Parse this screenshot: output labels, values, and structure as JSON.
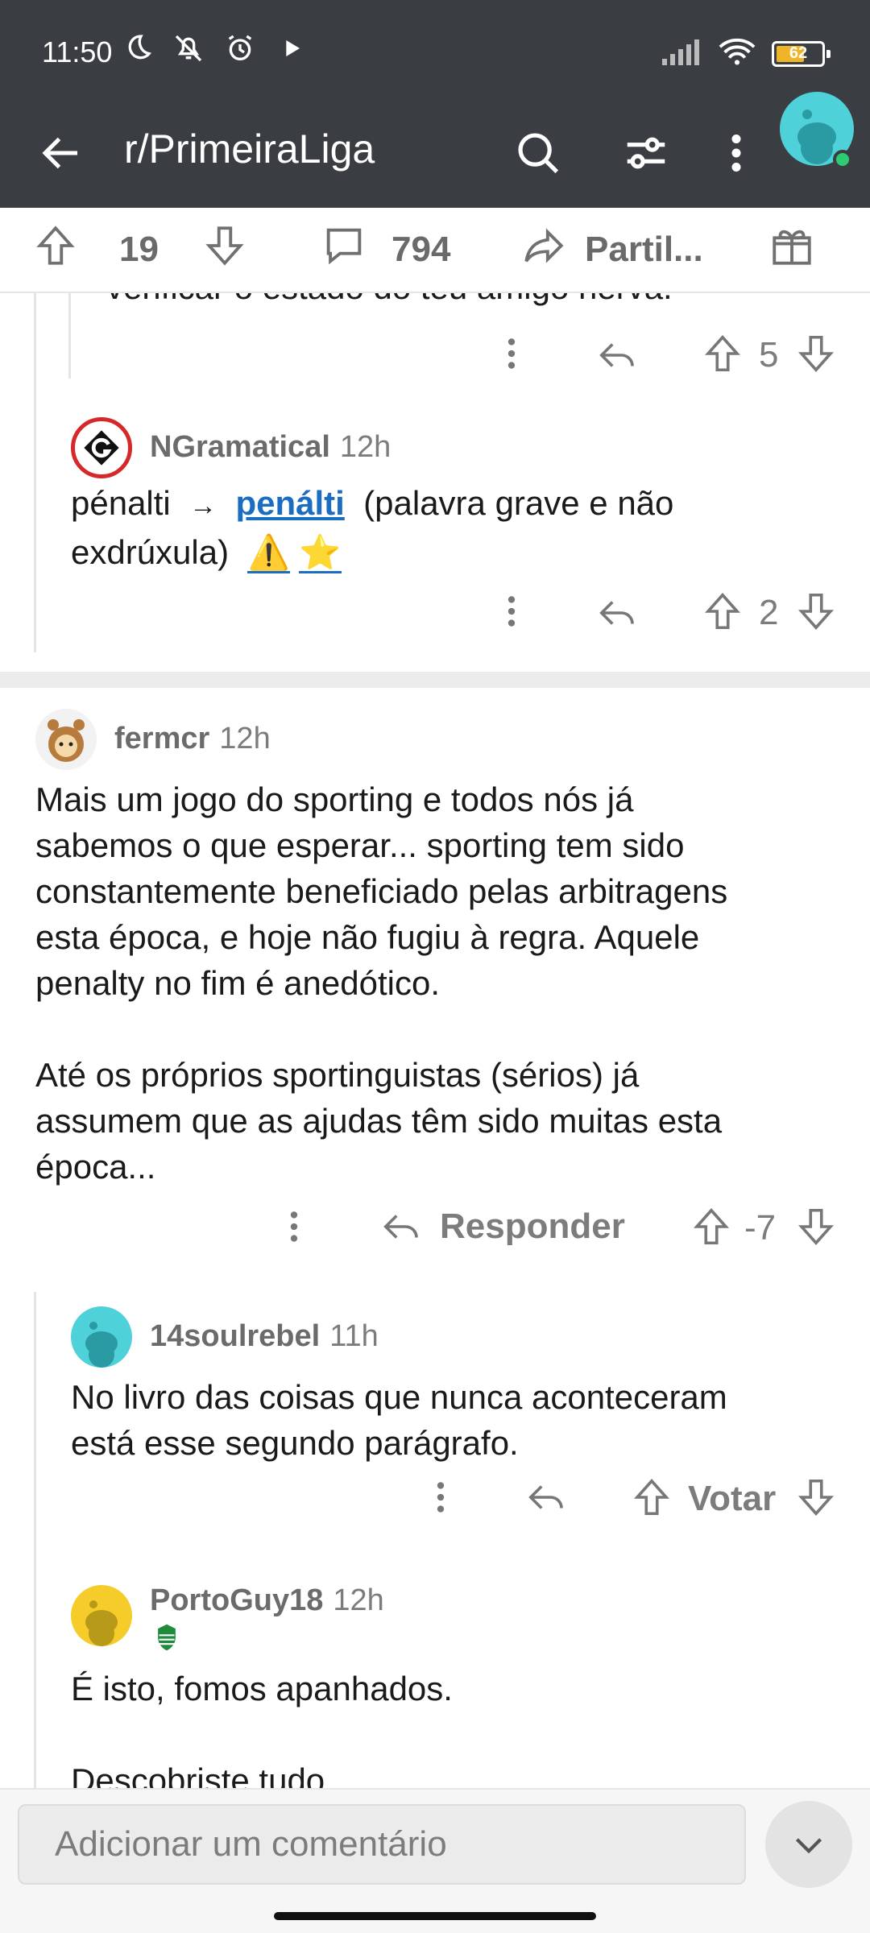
{
  "status_bar": {
    "time": "11:50",
    "battery": "62"
  },
  "header": {
    "title": "r/PrimeiraLiga"
  },
  "post_bar": {
    "upvotes": "19",
    "comments": "794",
    "share_label": "Partil..."
  },
  "comments": {
    "c0": {
      "partial_text": "verificar o estado do teu amigo nerva.",
      "score": "5"
    },
    "c1": {
      "user": "NGramatical",
      "time": "12h",
      "word": "pénalti",
      "arrow": "→",
      "correction": "penálti",
      "note": "(palavra grave e não",
      "line2": "exdrúxula)",
      "emoji1": "⚠️",
      "emoji2": "⭐",
      "score": "2"
    },
    "c2": {
      "user": "fermcr",
      "time": "12h",
      "lines": [
        "Mais um jogo do sporting e todos nós já",
        "sabemos o que esperar... sporting tem sido",
        "constantemente beneficiado pelas arbitragens",
        "esta época, e hoje não fugiu à regra. Aquele",
        "penalty no fim é anedótico."
      ],
      "lines2": [
        "Até os próprios sportinguistas (sérios) já",
        "assumem que as ajudas têm sido muitas esta",
        "época..."
      ],
      "reply_label": "Responder",
      "score": "-7"
    },
    "c3": {
      "user": "14soulrebel",
      "time": "11h",
      "lines": [
        "No livro das coisas que nunca aconteceram",
        "está esse segundo parágrafo."
      ],
      "vote_label": "Votar"
    },
    "c4": {
      "user": "PortoGuy18",
      "time": "12h",
      "line1": "É isto, fomos apanhados.",
      "line2": "Descobriste tudo"
    }
  },
  "composer": {
    "placeholder": "Adicionar um comentário"
  },
  "colors": {
    "header_bg": "#3a3e42",
    "avatar_teal": "#4fd1d9",
    "online": "#2ecc71",
    "link": "#1a6dc2"
  }
}
